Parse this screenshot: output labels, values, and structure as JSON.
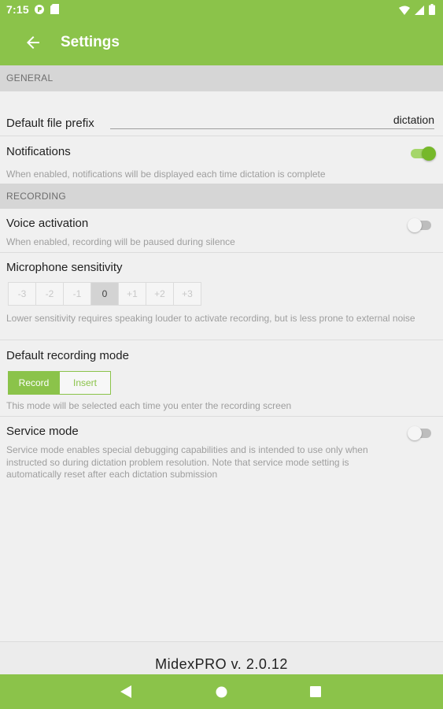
{
  "status_bar": {
    "time": "7:15",
    "icons": [
      "pocket-casts-icon",
      "sd-card-icon",
      "wifi-icon",
      "signal-icon",
      "battery-icon"
    ]
  },
  "app_bar": {
    "title": "Settings",
    "back_icon": "arrow-left-icon"
  },
  "colors": {
    "primary": "#8bc34a",
    "switch_on": "#76b82a",
    "section_bg": "#d6d6d6",
    "background": "#f0f0f0"
  },
  "sections": {
    "general": {
      "header": "General",
      "default_file_prefix": {
        "label": "Default file prefix",
        "value": "dictation"
      },
      "notifications": {
        "label": "Notifications",
        "description": "When enabled, notifications will be displayed each time dictation is complete",
        "enabled": true
      }
    },
    "recording": {
      "header": "Recording",
      "voice_activation": {
        "label": "Voice activation",
        "description": "When enabled, recording will be paused during silence",
        "enabled": false
      },
      "microphone_sensitivity": {
        "label": "Microphone sensitivity",
        "options": [
          "-3",
          "-2",
          "-1",
          "0",
          "+1",
          "+2",
          "+3"
        ],
        "selected": "0",
        "description": "Lower sensitivity requires speaking louder to activate recording, but is less prone to external noise"
      },
      "default_recording_mode": {
        "label": "Default recording mode",
        "options": [
          "Record",
          "Insert"
        ],
        "selected": "Record",
        "description": "This mode will be selected each time you enter the recording screen"
      },
      "service_mode": {
        "label": "Service mode",
        "description": "Service mode enables special debugging capabilities and is intended to use only when instructed so during dictation problem resolution. Note that service mode setting is automatically reset after each dictation submission",
        "enabled": false
      }
    }
  },
  "footer": {
    "version": "MidexPRO v. 2.0.12"
  },
  "nav_bar": {
    "icons": [
      "back-triangle-icon",
      "home-circle-icon",
      "recents-square-icon"
    ]
  }
}
